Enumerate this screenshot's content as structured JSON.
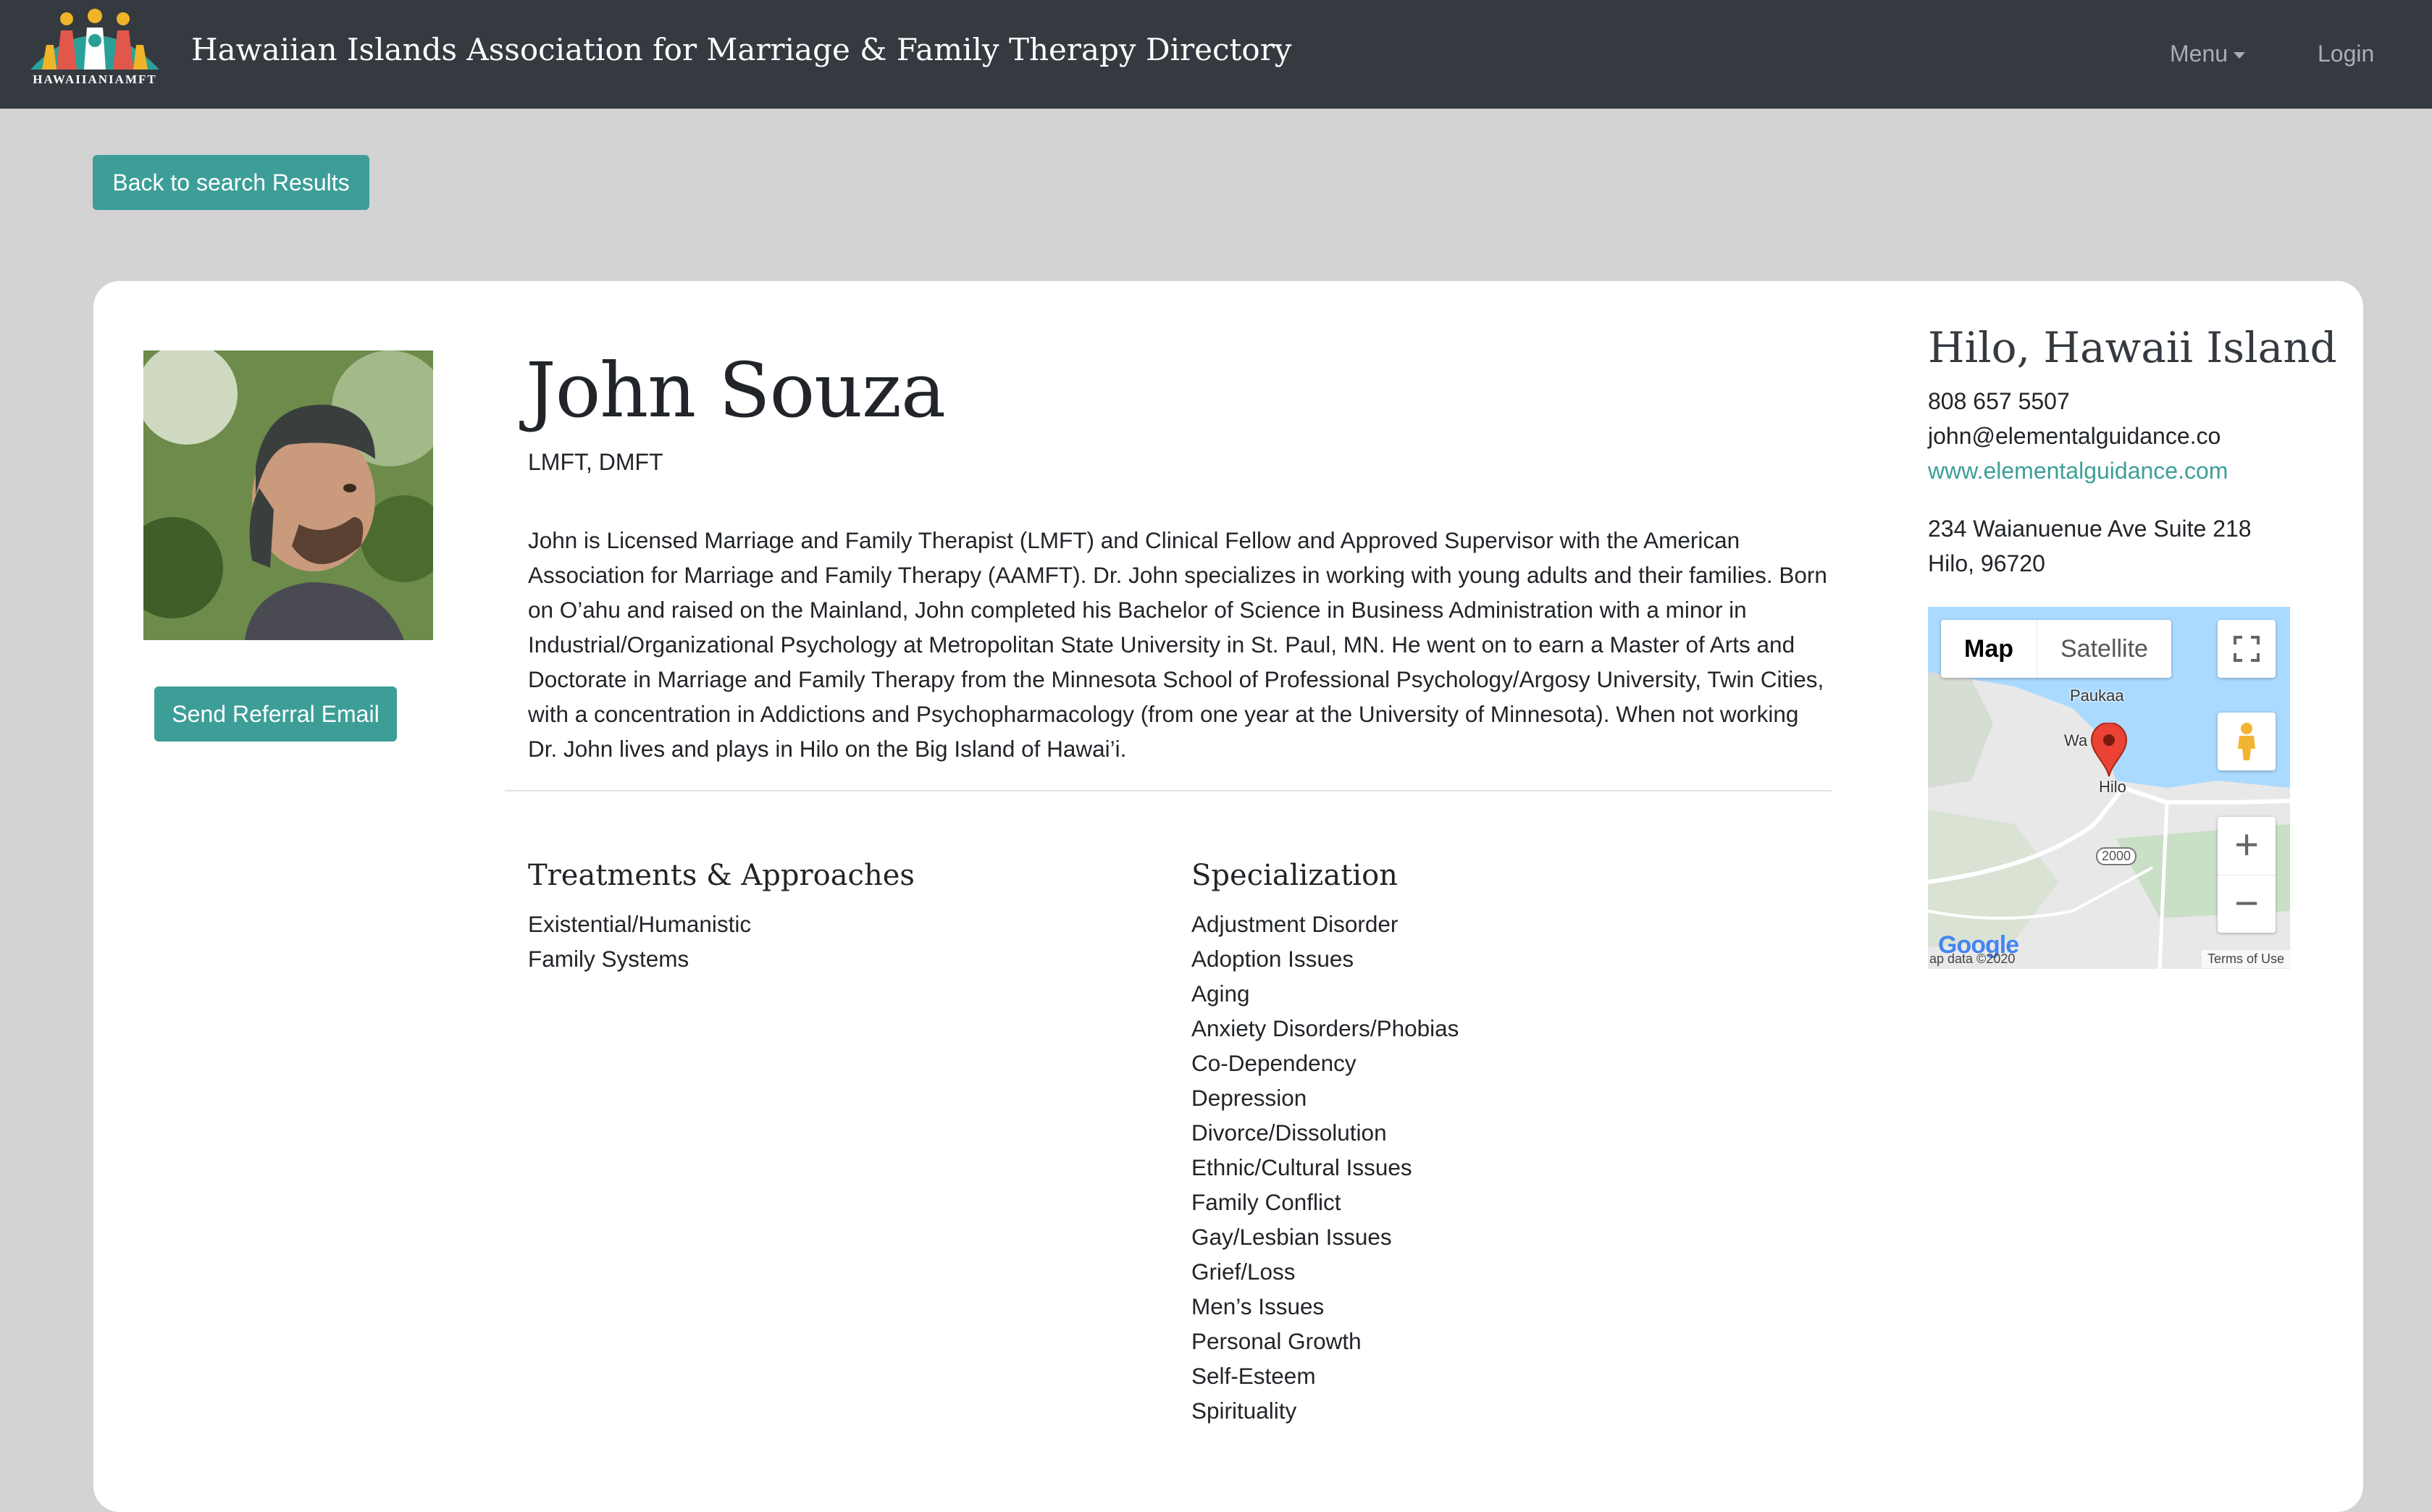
{
  "navbar": {
    "logo_text": "HAWAIIANIAMFT",
    "title": "Hawaiian Islands Association for Marriage & Family Therapy Directory",
    "menu_label": "Menu",
    "login_label": "Login"
  },
  "back_button": "Back to search Results",
  "profile": {
    "name": "John Souza",
    "credentials": "LMFT, DMFT",
    "referral_button": "Send Referral Email",
    "bio": "John is Licensed Marriage and Family Therapist (LMFT) and Clinical Fellow and Approved Supervisor with the American Association for Marriage and Family Therapy (AAMFT). Dr. John specializes in working with young adults and their families. Born on O’ahu and raised on the Mainland, John completed his Bachelor of Science in Business Administration with a minor in Industrial/Organizational Psychology at Metropolitan State University in St. Paul, MN. He went on to earn a Master of Arts and Doctorate in Marriage and Family Therapy from the Minnesota School of Professional Psychology/Argosy University, Twin Cities, with a concentration in Addictions and Psychopharmacology (from one year at the University of Minnesota). When not working Dr. John lives and plays in Hilo on the Big Island of Hawai’i."
  },
  "treatments": {
    "title": "Treatments & Approaches",
    "items": [
      "Existential/Humanistic",
      "Family Systems"
    ]
  },
  "specialization": {
    "title": "Specialization",
    "items": [
      "Adjustment Disorder",
      "Adoption Issues",
      "Aging",
      "Anxiety Disorders/Phobias",
      "Co-Dependency",
      "Depression",
      "Divorce/Dissolution",
      "Ethnic/Cultural Issues",
      "Family Conflict",
      "Gay/Lesbian Issues",
      "Grief/Loss",
      "Men’s Issues",
      "Personal Growth",
      "Self-Esteem",
      "Spirituality"
    ]
  },
  "contact": {
    "location": "Hilo, Hawaii Island",
    "phone": "808 657 5507",
    "email": "john@elementalguidance.co",
    "website": "www.elementalguidance.com",
    "address_line1": "234 Waianuenue Ave Suite 218",
    "address_line2": "Hilo, 96720"
  },
  "map": {
    "type_map": "Map",
    "type_satellite": "Satellite",
    "label_paukaa": "Paukaa",
    "label_wa": "Wa",
    "label_hilo": "Hilo",
    "highway": "2000",
    "google": "Google",
    "map_data": "ap data ©2020",
    "terms": "Terms of Use",
    "zoom_in": "+",
    "zoom_out": "−"
  },
  "colors": {
    "navbar": "#343a40",
    "accent": "#3d9e98",
    "page_bg": "#d3d3d3",
    "card_bg": "#ffffff"
  }
}
